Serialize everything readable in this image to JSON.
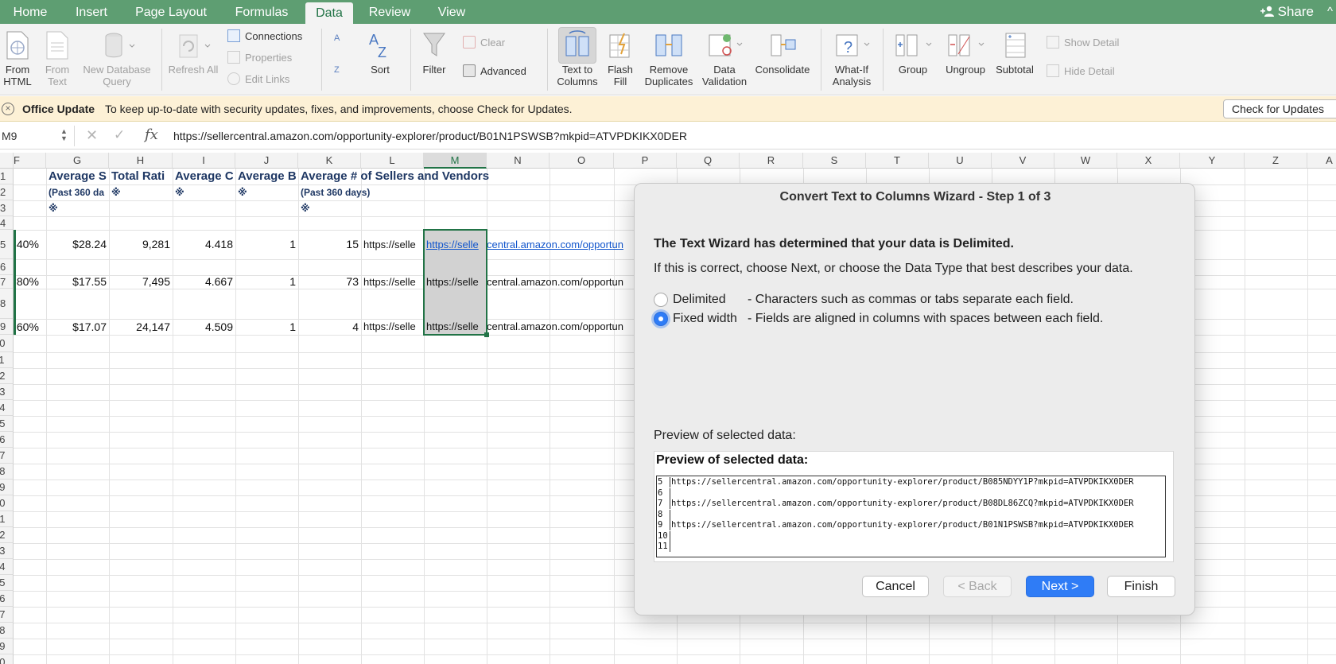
{
  "tabs": [
    "Home",
    "Insert",
    "Page Layout",
    "Formulas",
    "Data",
    "Review",
    "View"
  ],
  "active_tab": "Data",
  "share_label": "Share",
  "ribbon": {
    "from_html": "From HTML",
    "from_text": "From Text",
    "new_db_query": "New Database Query",
    "refresh_all": "Refresh All",
    "connections": "Connections",
    "properties": "Properties",
    "edit_links": "Edit Links",
    "sort": "Sort",
    "filter": "Filter",
    "clear": "Clear",
    "advanced": "Advanced",
    "text_to_columns": "Text to Columns",
    "flash_fill": "Flash Fill",
    "remove_duplicates": "Remove Duplicates",
    "data_validation": "Data Validation",
    "consolidate": "Consolidate",
    "what_if": "What-If Analysis",
    "group": "Group",
    "ungroup": "Ungroup",
    "subtotal": "Subtotal",
    "show_detail": "Show Detail",
    "hide_detail": "Hide Detail"
  },
  "update_bar": {
    "title": "Office Update",
    "message": "To keep up-to-date with security updates, fixes, and improvements, choose Check for Updates.",
    "button": "Check for Updates"
  },
  "formula_bar": {
    "name_box": "M9",
    "fx": "fx",
    "value": "https://sellercentral.amazon.com/opportunity-explorer/product/B01N1PSWSB?mkpid=ATVPDKIKX0DER"
  },
  "columns": [
    "F",
    "G",
    "H",
    "I",
    "J",
    "K",
    "L",
    "M",
    "N",
    "O",
    "P",
    "Q",
    "R",
    "S",
    "T",
    "U",
    "V",
    "W",
    "X",
    "Y",
    "Z",
    "A"
  ],
  "rows": [
    "1",
    "2",
    "3",
    "4",
    "5",
    "6",
    "7",
    "8",
    "9",
    "10",
    "11",
    "12",
    "13",
    "14",
    "15",
    "16",
    "17",
    "18",
    "19",
    "20",
    "21",
    "22",
    "23",
    "24",
    "25",
    "26",
    "27",
    "28",
    "29",
    "30",
    "31"
  ],
  "sheet": {
    "row1": {
      "G": "Average S",
      "H": "Total Rati",
      "I": "Average C",
      "J": "Average B",
      "K": "Average # of Sellers and Vendors"
    },
    "row2": {
      "G": "(Past 360 da",
      "H": "※",
      "I": "※",
      "J": "※",
      "K": "(Past 360 days)"
    },
    "row3": {
      "G": "※",
      "K": "※"
    },
    "data_rows": [
      {
        "F": ".40%",
        "G": "$28.24",
        "H": "9,281",
        "I": "4.418",
        "J": "1",
        "K": "15",
        "L": "https://selle",
        "M": "https://selle",
        "N": "central.amazon.com/opportun"
      },
      {
        "F": ".80%",
        "G": "$17.55",
        "H": "7,495",
        "I": "4.667",
        "J": "1",
        "K": "73",
        "L": "https://selle",
        "M": "https://selle",
        "N": "central.amazon.com/opportun"
      },
      {
        "F": ".60%",
        "G": "$17.07",
        "H": "24,147",
        "I": "4.509",
        "J": "1",
        "K": "4",
        "L": "https://selle",
        "M": "https://selle",
        "N": "central.amazon.com/opportun"
      }
    ]
  },
  "dialog": {
    "title": "Convert Text to Columns Wizard - Step 1 of 3",
    "heading": "The Text Wizard has determined that your data is Delimited.",
    "subheading": "If this is correct, choose Next, or choose the Data Type that best describes your data.",
    "options": [
      {
        "label": "Delimited",
        "desc": "- Characters such as commas or tabs separate each field.",
        "selected": false
      },
      {
        "label": "Fixed width",
        "desc": "- Fields are aligned in columns with spaces between each field.",
        "selected": true
      }
    ],
    "preview_label": "Preview of selected data:",
    "preview_title": "Preview of selected data:",
    "preview_lines": [
      {
        "n": "5",
        "text": "https://sellercentral.amazon.com/opportunity-explorer/product/B085NDYY1P?mkpid=ATVPDKIKX0DER"
      },
      {
        "n": "6",
        "text": ""
      },
      {
        "n": "7",
        "text": "https://sellercentral.amazon.com/opportunity-explorer/product/B08DL86ZCQ?mkpid=ATVPDKIKX0DER"
      },
      {
        "n": "8",
        "text": ""
      },
      {
        "n": "9",
        "text": "https://sellercentral.amazon.com/opportunity-explorer/product/B01N1PSWSB?mkpid=ATVPDKIKX0DER"
      },
      {
        "n": "10",
        "text": ""
      },
      {
        "n": "11",
        "text": ""
      }
    ],
    "buttons": {
      "cancel": "Cancel",
      "back": "< Back",
      "next": "Next >",
      "finish": "Finish"
    }
  },
  "colors": {
    "accent": "#217346",
    "tabbar": "#5e9e72",
    "primary_button": "#2f7cf6",
    "link": "#1155cc",
    "update_bar": "#fdf1d6"
  }
}
